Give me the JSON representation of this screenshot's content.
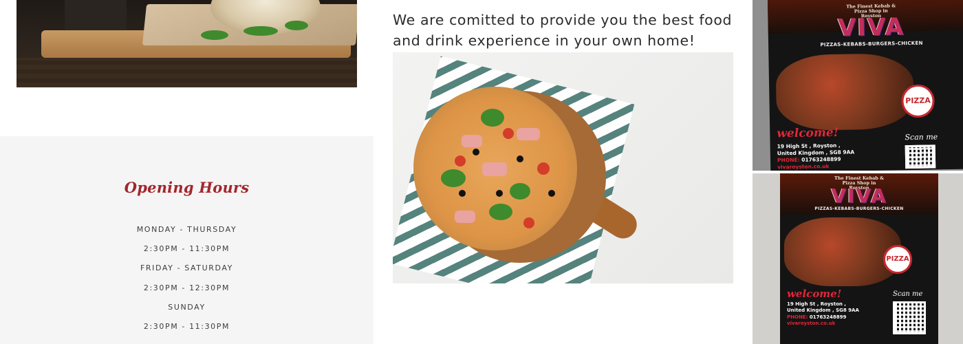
{
  "tagline": "We are comitted to provide you the best food and drink experience in your own home!",
  "opening_hours": {
    "title": "Opening Hours",
    "rows": [
      "MONDAY - THURSDAY",
      "2:30PM - 11:30PM",
      "FRIDAY - SATURDAY",
      "2:30PM - 12:30PM",
      "SUNDAY",
      "2:30PM - 11:30PM"
    ]
  },
  "flyer": {
    "shop_line": "The Finest Kebab & Pizza Shop in Royston",
    "logo": "VIVA",
    "categories": "PIZZAS-KEBABS-BURGERS-CHICKEN",
    "badge": "PIZZA",
    "welcome": "welcome!",
    "address_line1": "19 High St , Royston ,",
    "address_line2": "United Kingdom , SG8 9AA",
    "phone_label": "PHONE:",
    "phone": "01763248899",
    "website": "vivaroyston.co.uk",
    "scan": "Scan me"
  },
  "colors": {
    "accent": "#a3262d",
    "panel_bg": "#f5f5f5",
    "text": "#2b2b2b"
  }
}
